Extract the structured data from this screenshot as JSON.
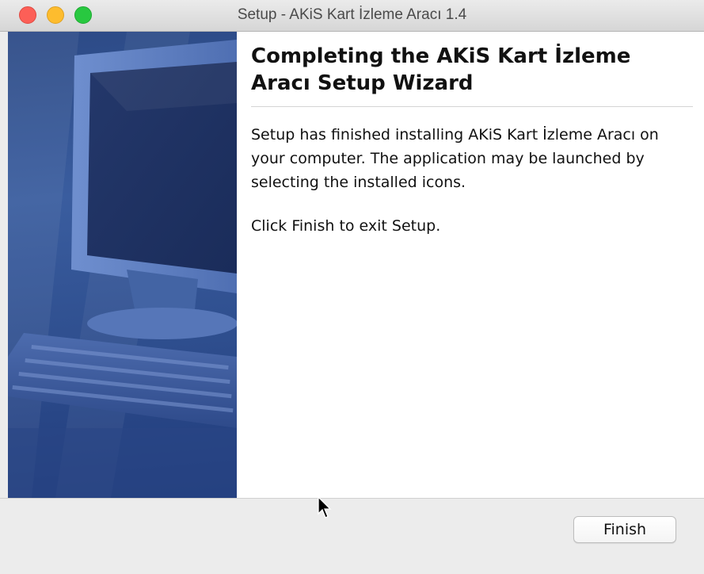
{
  "window": {
    "title": "Setup - AKiS Kart İzleme Aracı 1.4"
  },
  "wizard": {
    "heading": "Completing the AKiS Kart İzleme Aracı Setup Wizard",
    "paragraph1": "Setup has finished installing AKiS Kart İzleme Aracı on your computer. The application may be launched by selecting the installed icons.",
    "paragraph2": "Click Finish to exit Setup."
  },
  "buttons": {
    "finish": "Finish"
  },
  "icons": {
    "close": "close-dot",
    "minimize": "minimize-dot",
    "maximize": "maximize-dot",
    "cursor": "arrow-cursor"
  },
  "colors": {
    "close": "#fc5f57",
    "minimize": "#fdbc2e",
    "maximize": "#28c840",
    "sidebar": "#2f4f8f"
  }
}
